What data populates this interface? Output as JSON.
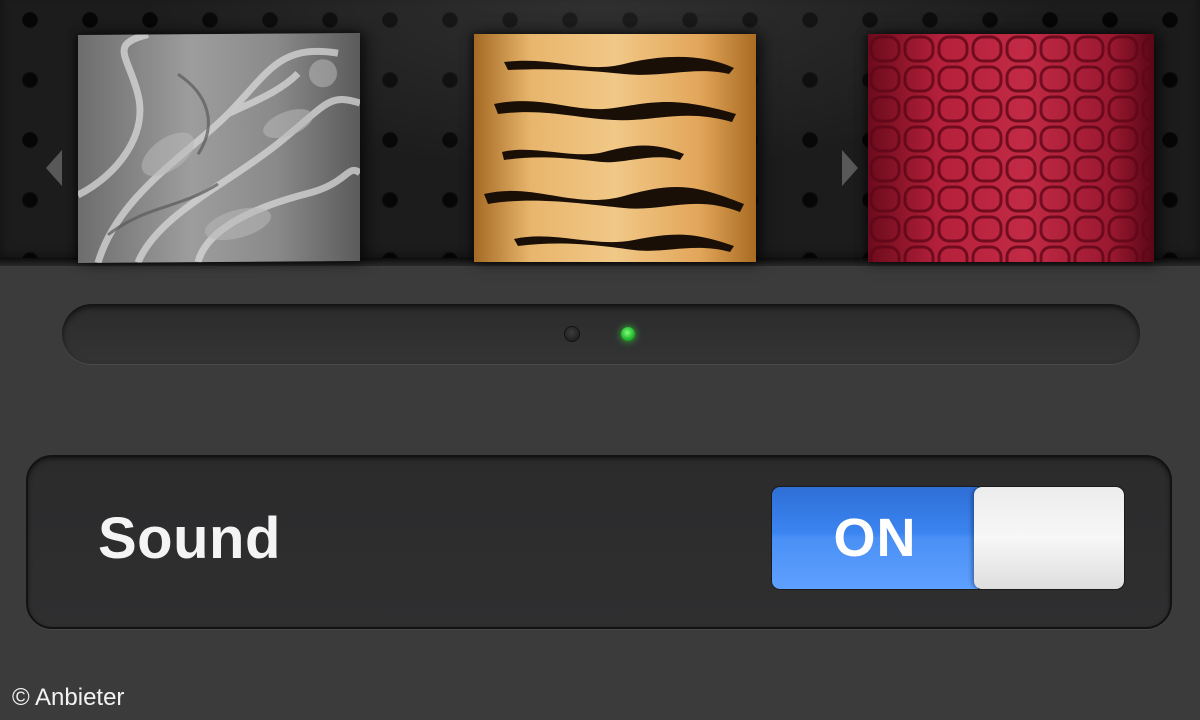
{
  "carousel": {
    "themes": [
      {
        "name": "paisley",
        "color": "#8a8a8a"
      },
      {
        "name": "tiger",
        "color": "#e2a65a"
      },
      {
        "name": "crocodile",
        "color": "#b5203b"
      }
    ],
    "page_count": 2,
    "current_page": 2,
    "active_dot_color": "#2fd23a"
  },
  "settings": {
    "sound": {
      "label": "Sound",
      "toggle_text": "ON",
      "state": "on",
      "on_color": "#3b84f0"
    }
  },
  "credit": "© Anbieter"
}
